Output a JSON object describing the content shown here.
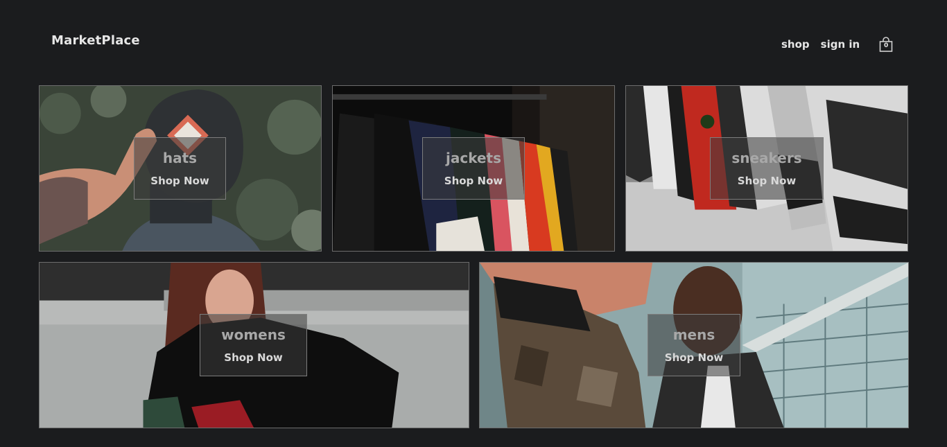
{
  "header": {
    "logo": "MarketPlace",
    "nav": {
      "shop": "shop",
      "sign_in": "sign in"
    },
    "cart": {
      "icon": "shopping-bag-icon",
      "count": "0"
    }
  },
  "categories": [
    {
      "title": "hats",
      "cta": "Shop Now"
    },
    {
      "title": "jackets",
      "cta": "Shop Now"
    },
    {
      "title": "sneakers",
      "cta": "Shop Now"
    },
    {
      "title": "womens",
      "cta": "Shop Now"
    },
    {
      "title": "mens",
      "cta": "Shop Now"
    }
  ],
  "colors": {
    "background": "#1b1c1e",
    "text": "#e6e6e6",
    "overlay_title": "#a8a8a8"
  }
}
